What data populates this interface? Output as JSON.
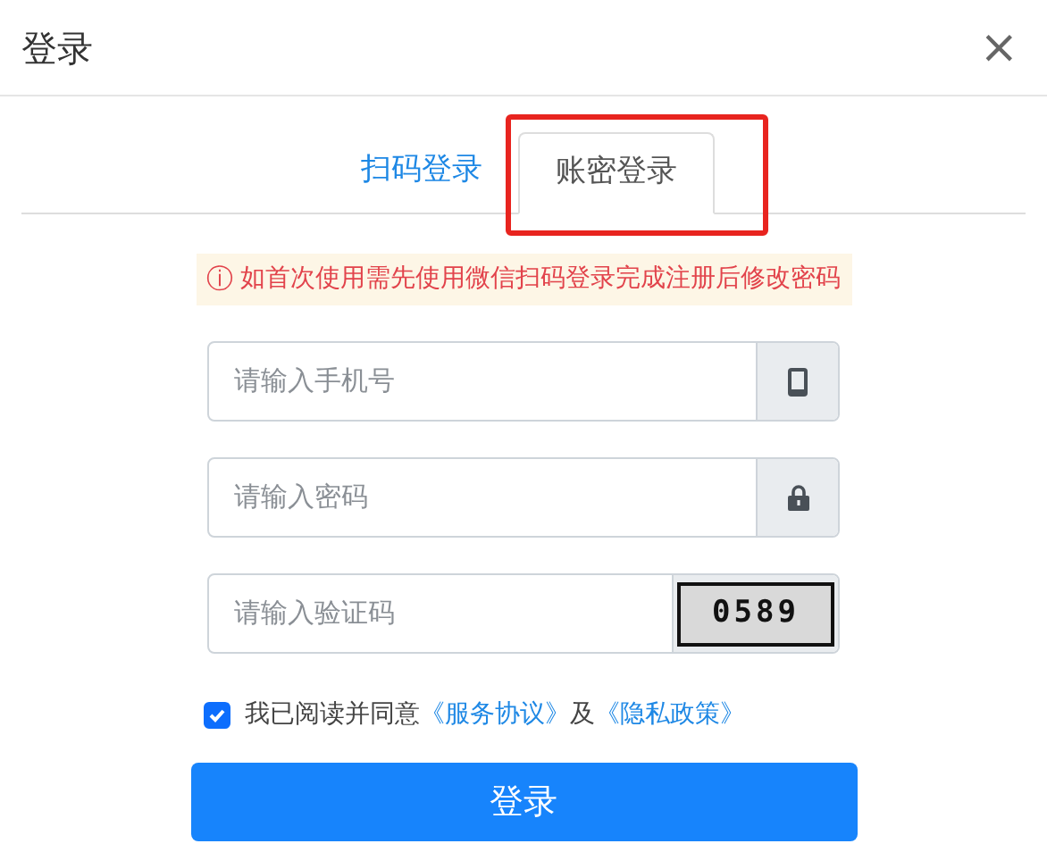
{
  "dialog": {
    "title": "登录",
    "close": "×"
  },
  "tabs": [
    {
      "label": "扫码登录",
      "selected": false
    },
    {
      "label": "账密登录",
      "selected": true
    }
  ],
  "notice": {
    "icon": "ⓘ",
    "text": "如首次使用需先使用微信扫码登录完成注册后修改密码"
  },
  "fields": [
    {
      "kind": "phone",
      "placeholder": "请输入手机号"
    },
    {
      "kind": "password",
      "placeholder": "请输入密码"
    },
    {
      "kind": "captcha",
      "placeholder": "请输入验证码",
      "code": "0589"
    }
  ],
  "agreement": {
    "checked": true,
    "text": "我已阅读并同意",
    "link1": "《服务协议》",
    "joiner": "及",
    "link2": "《隐私政策》"
  },
  "submit": "登录"
}
